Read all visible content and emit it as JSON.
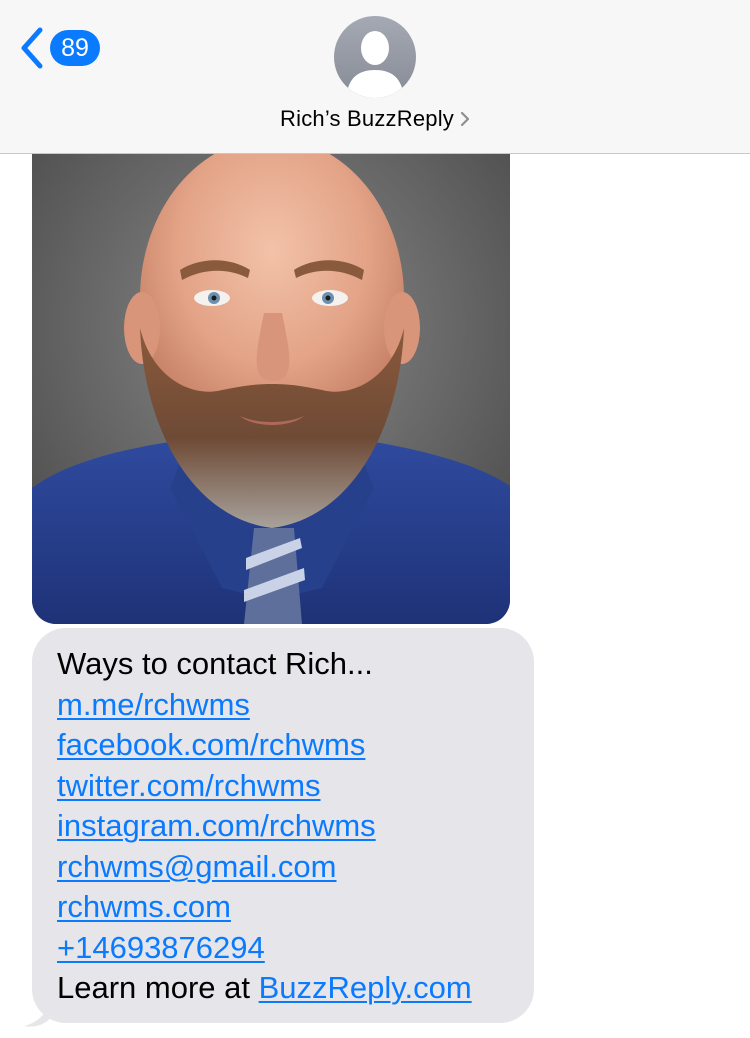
{
  "header": {
    "back_badge": "89",
    "contact_name": "Rich’s BuzzReply"
  },
  "message": {
    "intro": "Ways to contact Rich...",
    "links": [
      "m.me/rchwms",
      "facebook.com/rchwms",
      "twitter.com/rchwms",
      "instagram.com/rchwms",
      "rchwms@gmail.com",
      "rchwms.com",
      "+14693876294"
    ],
    "footer_prefix": "Learn more at ",
    "footer_link": "BuzzReply.com"
  },
  "colors": {
    "link": "#0a7aff",
    "bubble": "#e5e5ea",
    "header_bg": "#f7f7f7"
  },
  "icons": {
    "back": "chevron-left-icon",
    "avatar": "person-silhouette-icon",
    "details": "chevron-right-icon"
  }
}
